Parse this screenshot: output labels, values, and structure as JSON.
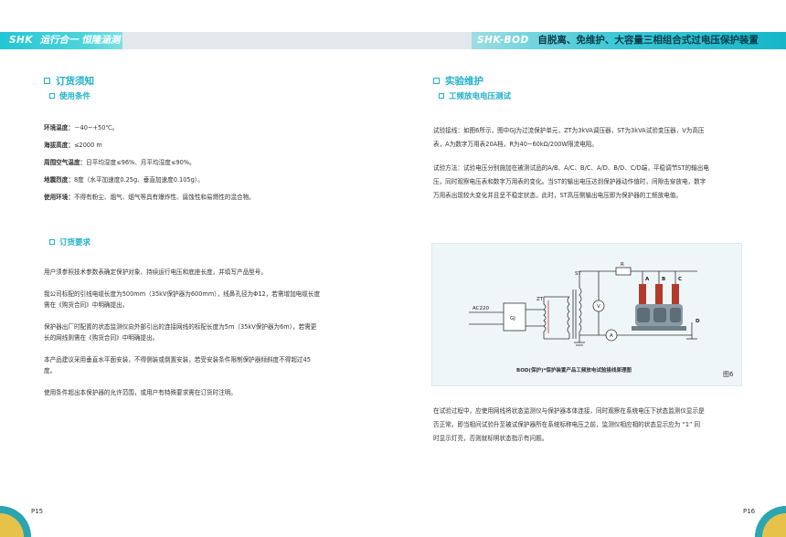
{
  "header": {
    "left_brand": "SHK",
    "left_slogan": "运行合一 恒隆涵测",
    "right_brand": "SHK-BOD",
    "right_title": "自脱离、免维护、大容量三相组合式过电压保护装置"
  },
  "left": {
    "section1_title": "订货须知",
    "section1_sub": "使用条件",
    "conditions": [
      {
        "label": "环境温度：",
        "value": "－40~+50℃。"
      },
      {
        "label": "海拔高度：",
        "value": "≤2000 m"
      },
      {
        "label": "周围空气温度：",
        "value": "日平均湿度≤96%、月平均湿度≤90%。"
      },
      {
        "label": "地震烈度：",
        "value": "8度（水平加速度0.25g、垂直加速度0.105g）。"
      },
      {
        "label": "使用环境：",
        "value": "不得有粉尘、烟气、烟气等具有爆炸性、腐蚀性和易燃性的混合物。"
      }
    ],
    "section2_sub": "订货要求",
    "order_paras": [
      [
        "用户须参照技术参数表确定保护对象、持续运行电压和底座长度，并填写产品型号。"
      ],
      [
        "我公司标配的引线电缆长度为500mm（35kV保护器为600mm），线鼻孔径为Φ12，若需增加电缆长度",
        "需在《购货合同》中明确提出。"
      ],
      [
        "保护器出厂时配置的状态监测仪向外部引出的连接网线的标配长度为5m（35kV保护器为6m），若需更",
        "长的网线则需在《购货合同》中明确提出。"
      ],
      [
        "本产品建议采用垂直水平面安装，不得侧装或倒置安装，若受安装条件限制保护器倾斜度不得超过45",
        "度。"
      ],
      [
        "使用条件超出本保护器的允许范围，或用户有特殊要求需在订货时注明。"
      ]
    ],
    "page_number": "P15"
  },
  "right": {
    "section_title": "实验维护",
    "section_sub": "工频放电电压测试",
    "wiring_lines": [
      "试验接线：如图6所示，图中GJ为过流保护单元，ZT为3kVA调压器，ST为3kVA试验变压器，V为高压",
      "表，A为数字万用表20A档，R为40~60kΩ/200W限流电阻。"
    ],
    "method_lines": [
      "试验方法：试验电压分别施加在被测试品的A/B、A/C、B/C、A/D、B/D、C/D端，平稳调节ST的输出电",
      "压，同时观察电压表和数字万用表的变化。当ST的输出电压达到保护器动作值时，间隙击穿放电，数字",
      "万用表出现较大变化并且呈不稳定状态，此时，ST高压侧输出电压即为保护器的工频放电值。"
    ],
    "diagram": {
      "labels": {
        "st": "ST",
        "r": "R",
        "zt": "ZT",
        "gj": "GJ",
        "ac": "AC220",
        "v": "V",
        "a": "A",
        "pa": "A",
        "pb": "B",
        "pc": "C",
        "pd": "D"
      },
      "caption": "BOD(保护)*保护装置产品工频放电试验接线原理图",
      "fig": "图6"
    },
    "after_lines": [
      "在试验过程中，应使用网线将状态监测仪与保护器本体连接，同时观察在系统电压下状态监测仪显示是",
      "否正常。即当相间试验升至被试保护器所在系统标称电压之前，监测仪相应相的状态显示应为 “1” 同",
      "时显示灯亮，否则就标明状态指示有问题。"
    ],
    "page_number": "P16"
  },
  "colors": {
    "accent": "#1fb0c9",
    "band_dark": "#15b7c9",
    "corner_gold": "#e7c24b",
    "corner_teal": "#2ba5b0"
  }
}
